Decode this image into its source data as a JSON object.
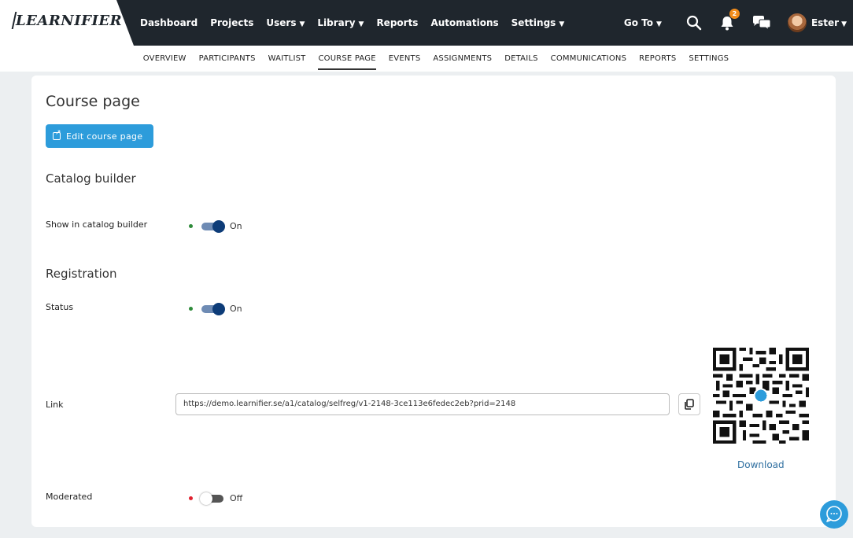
{
  "brand": {
    "logo_text": "LEARNIFIER"
  },
  "main_nav": [
    {
      "label": "Dashboard",
      "has_caret": false
    },
    {
      "label": "Projects",
      "has_caret": false
    },
    {
      "label": "Users",
      "has_caret": true
    },
    {
      "label": "Library",
      "has_caret": true
    },
    {
      "label": "Reports",
      "has_caret": false
    },
    {
      "label": "Automations",
      "has_caret": false
    },
    {
      "label": "Settings",
      "has_caret": true
    }
  ],
  "header_tools": {
    "goto_label": "Go To",
    "notification_count": "2",
    "user_name": "Ester",
    "icons": [
      "search-icon",
      "bell-icon",
      "chat-bubbles-icon",
      "avatar"
    ]
  },
  "sub_nav": {
    "tabs": [
      "OVERVIEW",
      "PARTICIPANTS",
      "WAITLIST",
      "COURSE PAGE",
      "EVENTS",
      "ASSIGNMENTS",
      "DETAILS",
      "COMMUNICATIONS",
      "REPORTS",
      "SETTINGS"
    ],
    "active": "COURSE PAGE"
  },
  "card": {
    "title": "Course page",
    "edit_button": "Edit course page",
    "catalog": {
      "heading": "Catalog builder",
      "show_label": "Show in catalog builder",
      "show_state": "On"
    },
    "registration": {
      "heading": "Registration",
      "status_label": "Status",
      "status_state": "On",
      "link_label": "Link",
      "link_value": "https://demo.learnifier.se/a1/catalog/selfreg/v1-2148-3ce113e6fedec2eb?prid=2148",
      "download_label": "Download",
      "moderated_label": "Moderated",
      "moderated_state": "Off"
    }
  },
  "colors": {
    "topbar": "#1f262d",
    "primary_button": "#2d9cdb",
    "toggle_on": "#0d3c78",
    "status_on_dot": "#2e8b3a",
    "status_off_dot": "#e0212f",
    "badge": "#f28c1b",
    "link": "#2f6fa0"
  }
}
